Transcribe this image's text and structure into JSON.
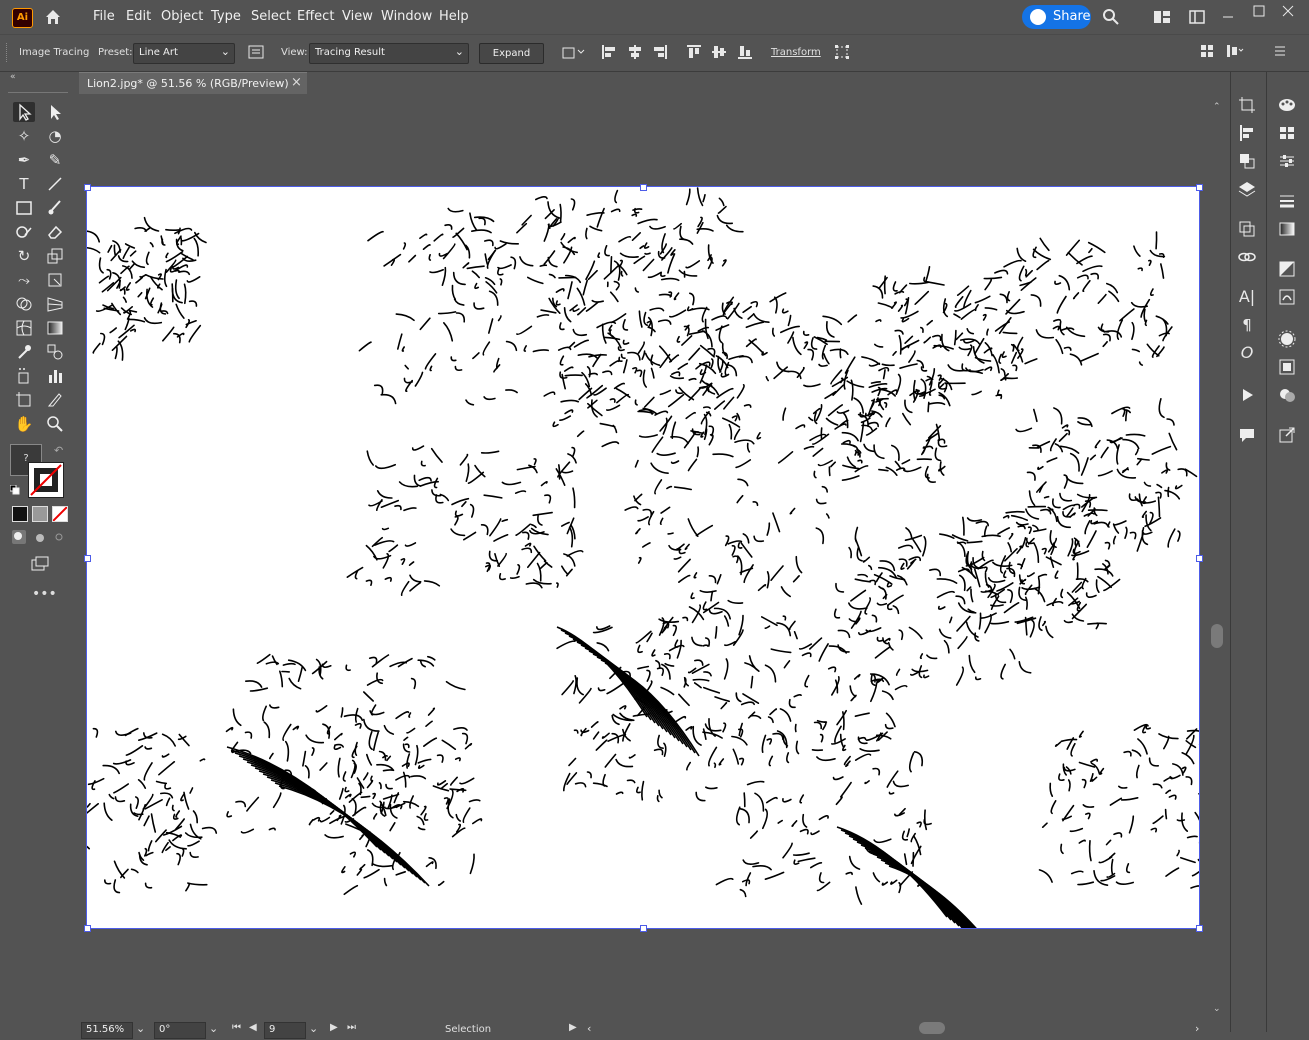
{
  "app": {
    "logo": "Ai",
    "menus": [
      "File",
      "Edit",
      "Object",
      "Type",
      "Select",
      "Effect",
      "View",
      "Window",
      "Help"
    ],
    "share_label": "Share",
    "accent": "#1473e6"
  },
  "controlbar": {
    "panel_name": "Image Tracing",
    "preset_label": "Preset:",
    "preset_value": "Line Art",
    "view_label": "View:",
    "view_value": "Tracing Result",
    "expand_label": "Expand",
    "transform_label": "Transform"
  },
  "document": {
    "tab_title": "Lion2.jpg* @ 51.56 % (RGB/Preview)",
    "close_glyph": "×"
  },
  "status": {
    "zoom": "51.56%",
    "rotation": "0°",
    "artboard_number": "9",
    "tool_name": "Selection"
  },
  "icons": {
    "home": "home-icon",
    "search": "search-icon",
    "arrange": "arrange-documents-icon",
    "workspace": "workspace-icon"
  }
}
